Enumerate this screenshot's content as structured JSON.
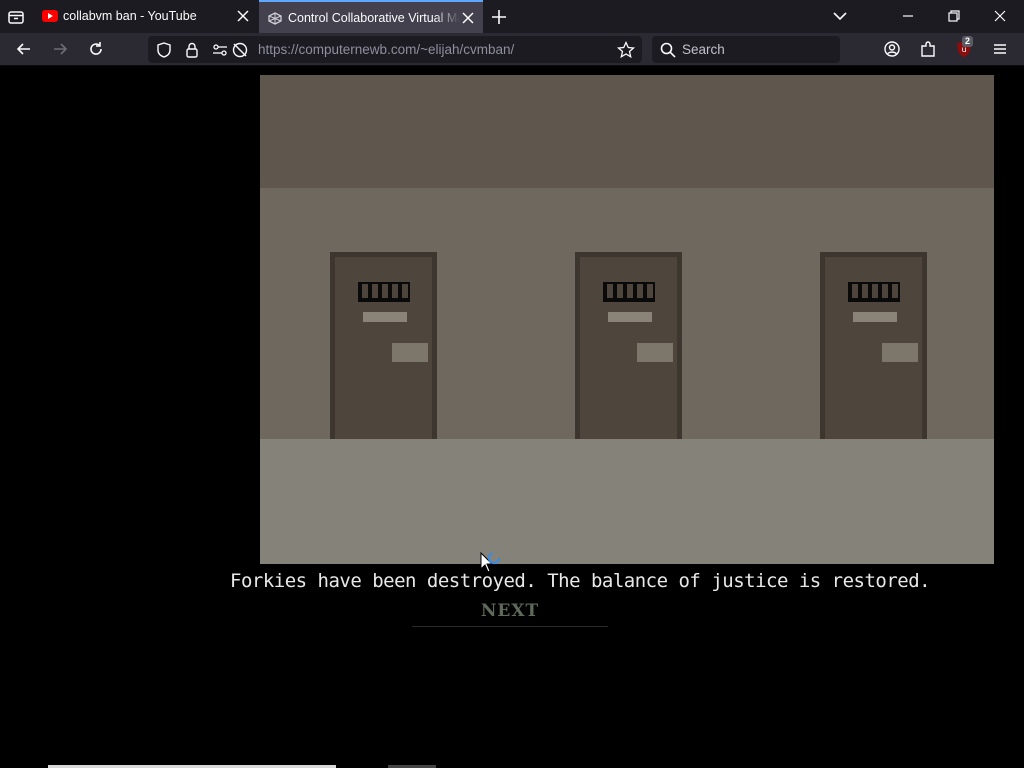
{
  "tabs": [
    {
      "title": "collabvm ban - YouTube",
      "favicon": "youtube-icon",
      "active": false
    },
    {
      "title": "Control Collaborative Virtual Ma",
      "favicon": "collabvm-icon",
      "active": true
    }
  ],
  "nav": {
    "url_host": "https://computernewb.com",
    "url_path": "/~elijah/cvmban/",
    "search_placeholder": "Search",
    "extension_badge": "2"
  },
  "game": {
    "caption": "Forkies have been destroyed. The balance of justice is restored.",
    "next_label": "NEXT",
    "doors": 3
  },
  "colors": {
    "tab_strip": "#1c1b22",
    "active_tab": "#42414d",
    "active_tab_accent": "#5fa8ff",
    "nav_bar": "#2b2a33",
    "ceiling": "#5f574d",
    "wall": "#6e685e",
    "floor": "#85827a",
    "door": "#4e463c",
    "next_text": "#5f6b5a"
  }
}
